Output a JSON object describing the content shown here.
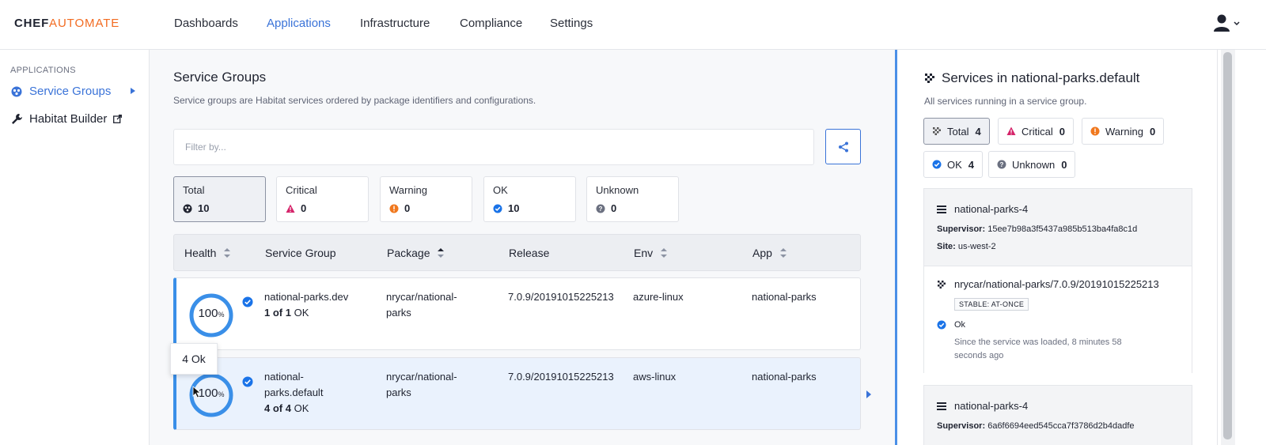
{
  "brand": {
    "part1": "CHEF",
    "part2": "AUTOMATE"
  },
  "nav": {
    "items": [
      "Dashboards",
      "Applications",
      "Infrastructure",
      "Compliance",
      "Settings"
    ],
    "active": "Applications"
  },
  "sidebar": {
    "caption": "APPLICATIONS",
    "items": [
      {
        "label": "Service Groups",
        "icon": "service-groups-icon"
      },
      {
        "label": "Habitat Builder",
        "icon": "wrench-icon"
      }
    ]
  },
  "main": {
    "title": "Service Groups",
    "subtitle": "Service groups are Habitat services ordered by package identifiers and configurations.",
    "filter_placeholder": "Filter by...",
    "stats": [
      {
        "label": "Total",
        "value": "10"
      },
      {
        "label": "Critical",
        "value": "0"
      },
      {
        "label": "Warning",
        "value": "0"
      },
      {
        "label": "OK",
        "value": "10"
      },
      {
        "label": "Unknown",
        "value": "0"
      }
    ],
    "columns": [
      "Health",
      "Service Group",
      "Package",
      "Release",
      "Env",
      "App"
    ],
    "rows": [
      {
        "health": "100",
        "unit": "%",
        "group": "national-parks.dev",
        "count": "1 of 1",
        "status": "OK",
        "package": "nrycar/national-parks",
        "release": "7.0.9/20191015225213",
        "env": "azure-linux",
        "app": "national-parks"
      },
      {
        "health": "100",
        "unit": "%",
        "group": "national-parks.default",
        "count": "4 of 4",
        "status": "OK",
        "package": "nrycar/national-parks",
        "release": "7.0.9/20191015225213",
        "env": "aws-linux",
        "app": "national-parks"
      }
    ],
    "tooltip": "4 Ok"
  },
  "panel": {
    "title": "Services in national-parks.default",
    "subtitle": "All services running in a service group.",
    "chips": [
      {
        "label": "Total",
        "value": "4"
      },
      {
        "label": "Critical",
        "value": "0"
      },
      {
        "label": "Warning",
        "value": "0"
      },
      {
        "label": "OK",
        "value": "4"
      },
      {
        "label": "Unknown",
        "value": "0"
      }
    ],
    "cards": [
      {
        "name": "national-parks-4",
        "supervisor_label": "Supervisor:",
        "supervisor": "15ee7b98a3f5437a985b513ba4fa8c1d",
        "site_label": "Site:",
        "site": "us-west-2",
        "package": "nrycar/national-parks/7.0.9/20191015225213",
        "badge": "STABLE: AT-ONCE",
        "status": "Ok",
        "since": "Since the service was loaded, 8 minutes 58 seconds ago"
      },
      {
        "name": "national-parks-4",
        "supervisor_label": "Supervisor:",
        "supervisor": "6a6f6694eed545cca7f3786d2b4dadfe"
      }
    ]
  },
  "colors": {
    "accent": "#3a73d8",
    "ok": "#1a73e8",
    "critical": "#d5246a",
    "warning": "#f0781e",
    "unknown": "#6b7080",
    "brand_orange": "#f26b21"
  }
}
